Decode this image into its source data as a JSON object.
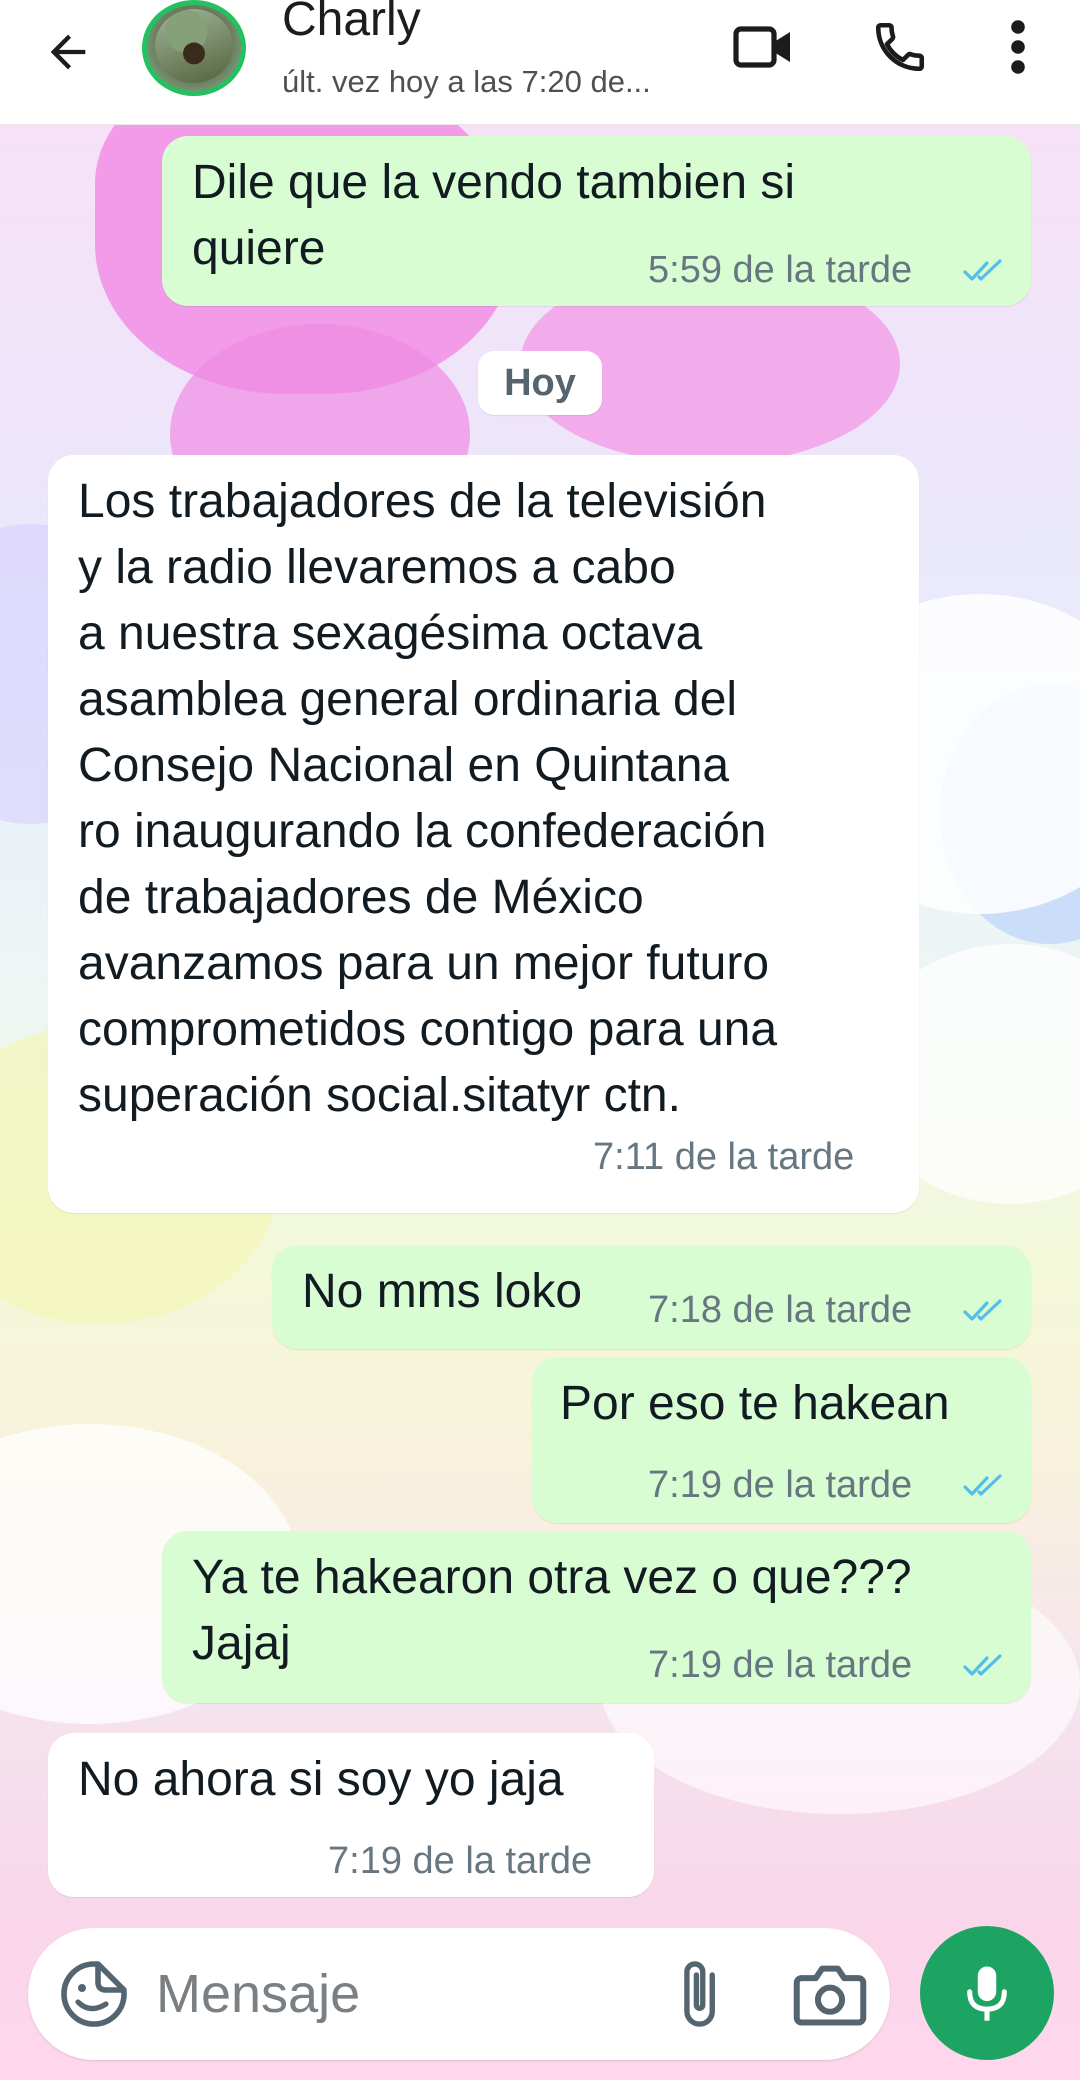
{
  "header": {
    "contact_name": "Charly",
    "status": "últ. vez hoy a las 7:20 de..."
  },
  "chat": {
    "date_separator": "Hoy",
    "messages": [
      {
        "direction": "out",
        "lines": [
          "Dile que la vendo tambien si",
          "quiere"
        ],
        "time": "5:59 de la tarde",
        "read": true
      },
      {
        "direction": "in",
        "lines": [
          "Los trabajadores de la televisión",
          "y la radio llevaremos a cabo",
          "a nuestra sexagésima octava",
          "asamblea general ordinaria del",
          "Consejo Nacional en Quintana",
          "ro inaugurando la confederación",
          "de trabajadores de México",
          "avanzamos para un mejor futuro",
          "comprometidos contigo para una",
          "superación social.sitatyr ctn."
        ],
        "time": "7:11 de la tarde"
      },
      {
        "direction": "out",
        "lines": [
          "No mms loko"
        ],
        "time": "7:18 de la tarde",
        "read": true
      },
      {
        "direction": "out",
        "lines": [
          "Por eso te hakean"
        ],
        "time": "7:19 de la tarde",
        "read": true
      },
      {
        "direction": "out",
        "lines": [
          "Ya te hakearon otra vez o que???",
          "Jajaj"
        ],
        "time": "7:19 de la tarde",
        "read": true
      },
      {
        "direction": "in",
        "lines": [
          "No ahora si soy yo jaja"
        ],
        "time": "7:19 de la tarde"
      }
    ]
  },
  "composer": {
    "placeholder": "Mensaje"
  },
  "colors": {
    "outgoing_bubble": "#d9fdd3",
    "incoming_bubble": "#ffffff",
    "accent_green": "#1da462",
    "read_ticks": "#53bdeb"
  },
  "icons": [
    "arrow-back-icon",
    "video-call-icon",
    "phone-icon",
    "more-vert-icon",
    "sticker-icon",
    "paperclip-icon",
    "camera-icon",
    "mic-icon",
    "double-check-icon"
  ]
}
